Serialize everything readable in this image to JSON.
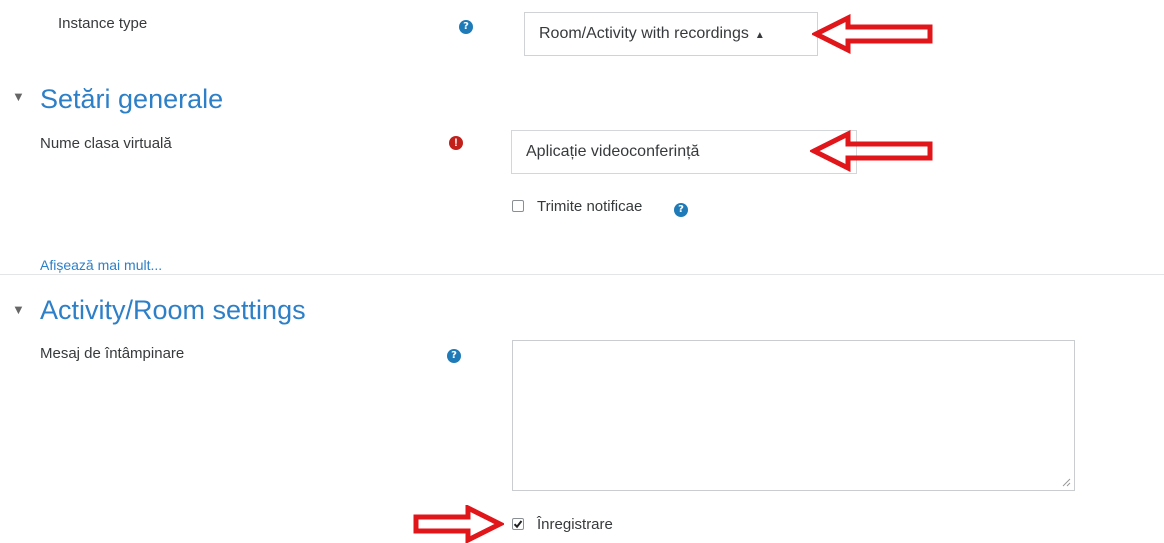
{
  "instance": {
    "label": "Instance type",
    "select_value": "Room/Activity with recordings",
    "help_icon": "question-circle-icon"
  },
  "general": {
    "title": "Setări generale",
    "name_label": "Nume clasa virtuală",
    "name_value": "Aplicație videoconferință",
    "required_icon": "exclamation-circle-icon",
    "notify_label": "Trimite notificae",
    "notify_checked": false,
    "show_more": "Afișează mai mult..."
  },
  "room": {
    "title": "Activity/Room settings",
    "welcome_label": "Mesaj de întâmpinare",
    "welcome_value": "",
    "record_label": "Înregistrare",
    "record_checked": true
  },
  "colors": {
    "accent": "#2d7fc7",
    "help": "#1f7ab8",
    "required": "#c1201b",
    "arrow": "#e0161b"
  }
}
